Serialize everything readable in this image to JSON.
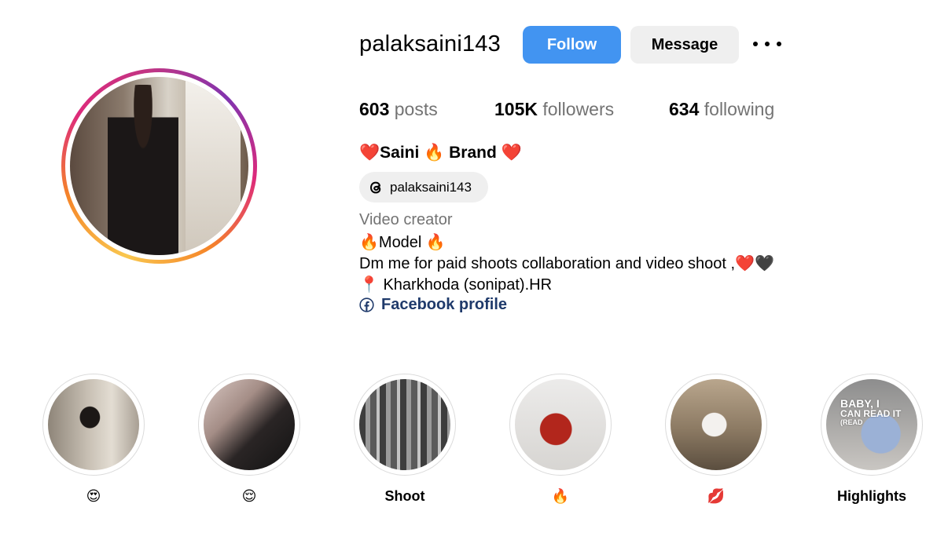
{
  "profile": {
    "username": "palaksaini143",
    "follow_label": "Follow",
    "message_label": "Message",
    "more_icon": "more-horizontal-icon"
  },
  "stats": {
    "posts_count": "603",
    "posts_label": "posts",
    "followers_count": "105K",
    "followers_label": "followers",
    "following_count": "634",
    "following_label": "following"
  },
  "bio": {
    "full_name": "❤️Saini 🔥 Brand ❤️",
    "threads_handle": "palaksaini143",
    "category": "Video creator",
    "lines": [
      "🔥Model 🔥",
      "Dm me for paid shoots collaboration and video shoot ,❤️🖤",
      "📍 Kharkhoda (sonipat).HR"
    ],
    "facebook_link": "Facebook profile"
  },
  "highlights": [
    {
      "label": "😍"
    },
    {
      "label": "😌"
    },
    {
      "label": "Shoot"
    },
    {
      "label": "🔥"
    },
    {
      "label": "💋"
    },
    {
      "label": "Highlights",
      "cover_text": [
        "BABY, I",
        "CAN READ IT",
        "(READ"
      ]
    }
  ],
  "colors": {
    "follow_button": "#4294f1",
    "secondary_button": "#efefef",
    "muted_text": "#737373",
    "link_text": "#1f3a6b"
  }
}
